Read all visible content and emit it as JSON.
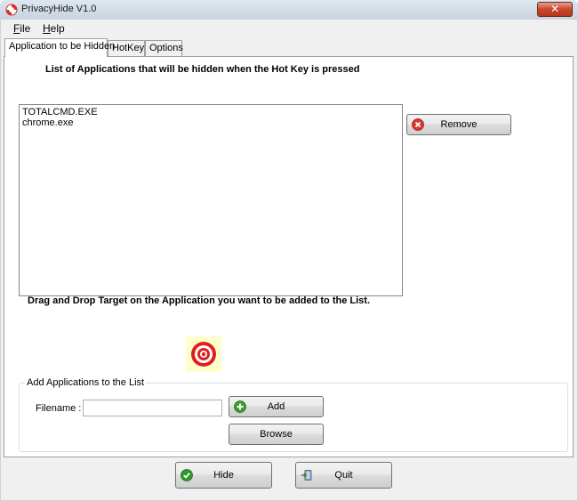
{
  "window": {
    "title": "PrivacyHide V1.0",
    "close_label": "✕"
  },
  "menu": {
    "file": {
      "mnemonic": "F",
      "rest": "ile"
    },
    "help": {
      "mnemonic": "H",
      "rest": "elp"
    }
  },
  "tabs": [
    {
      "label": "Application to be Hidden",
      "active": true
    },
    {
      "label": "HotKey",
      "active": false
    },
    {
      "label": "Options",
      "active": false
    }
  ],
  "apps_panel": {
    "heading": "List of Applications that will be hidden when the Hot Key is pressed",
    "items": [
      "TOTALCMD.EXE",
      "chrome.exe"
    ],
    "remove_label": "Remove",
    "drag_heading": "Drag and Drop Target on the Application you want to be added to the List.",
    "target_icon": "crosshair-target-icon"
  },
  "add_group": {
    "legend": "Add Applications to the List",
    "filename_label": "Filename :",
    "filename_value": "",
    "add_label": "Add",
    "browse_label": "Browse"
  },
  "footer": {
    "hide_label": "Hide",
    "quit_label": "Quit"
  },
  "colors": {
    "remove_icon": "#d9372a",
    "add_icon": "#3a9e2f",
    "hide_icon": "#2e9a2e",
    "target_red": "#e0201b",
    "target_bg": "#ffffcc"
  }
}
